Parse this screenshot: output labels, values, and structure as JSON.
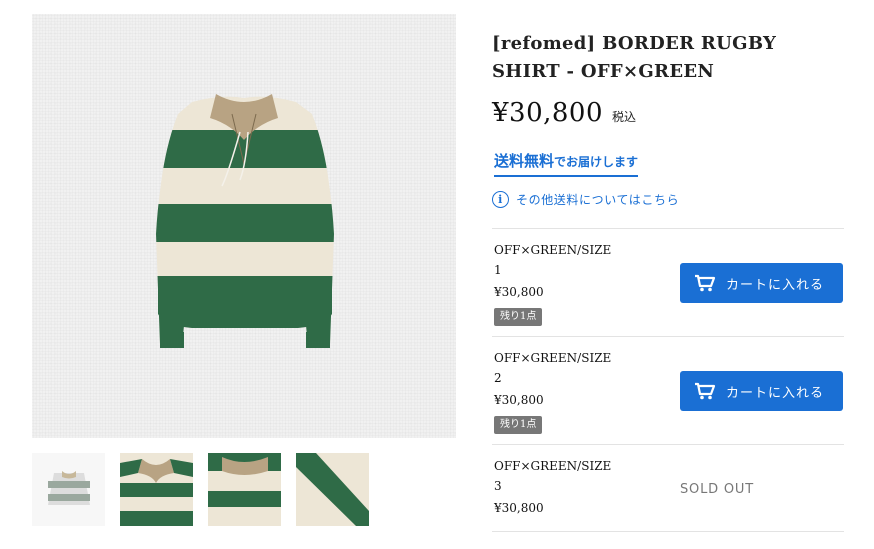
{
  "product": {
    "title": "[refomed] BORDER RUGBY SHIRT - OFF×GREEN",
    "price": "¥30,800",
    "tax_label": "税込"
  },
  "shipping": {
    "free_label": "送料無料",
    "free_suffix": "でお届けします",
    "other_link": "その他送料についてはこちら"
  },
  "variants": [
    {
      "name": "OFF×GREEN/SIZE 1",
      "price": "¥30,800",
      "badge": "残り1点",
      "action": "カートに入れる"
    },
    {
      "name": "OFF×GREEN/SIZE 2",
      "price": "¥30,800",
      "badge": "残り1点",
      "action": "カートに入れる"
    },
    {
      "name": "OFF×GREEN/SIZE 3",
      "price": "¥30,800",
      "badge": "",
      "action": "SOLD OUT"
    }
  ],
  "icons": {
    "cart": "cart-icon",
    "info": "info-icon"
  },
  "colors": {
    "accent": "#1a6fd4",
    "badge": "#777777",
    "shirt_green": "#2f6b47",
    "shirt_off": "#ede6d6",
    "collar": "#b8a383"
  }
}
